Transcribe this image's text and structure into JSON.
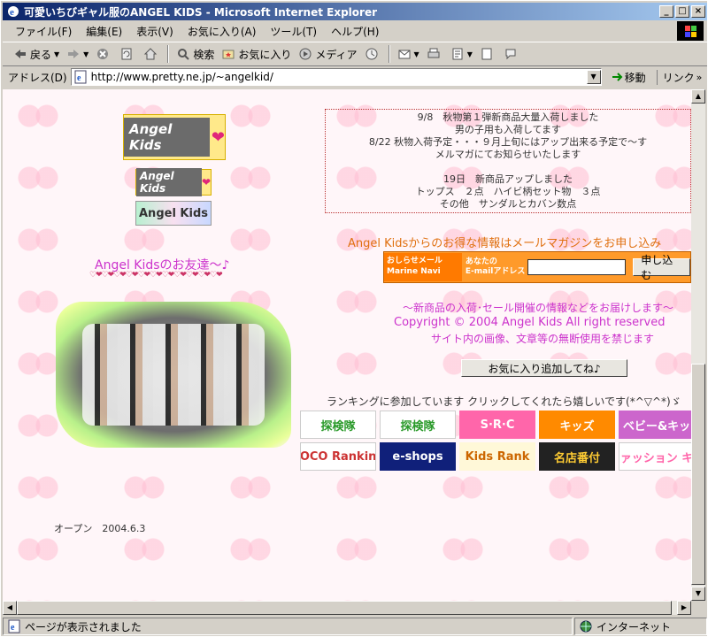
{
  "window": {
    "title": "可愛いちびギャル服のANGEL KIDS - Microsoft Internet Explorer",
    "controls": {
      "minimize": "_",
      "maximize": "□",
      "close": "×"
    }
  },
  "menu": [
    "ファイル(F)",
    "編集(E)",
    "表示(V)",
    "お気に入り(A)",
    "ツール(T)",
    "ヘルプ(H)"
  ],
  "toolbar": {
    "back": "戻る",
    "search": "検索",
    "favorites": "お気に入り",
    "media": "メディア"
  },
  "address": {
    "label": "アドレス(D)",
    "url": "http://www.pretty.ne.jp/~angelkid/",
    "go": "移動",
    "links": "リンク"
  },
  "status": {
    "text": "ページが表示されました",
    "zone": "インターネット"
  },
  "page": {
    "logo_big": "Angel Kids",
    "logo_small": "Angel Kids",
    "logo_text": "Angel Kids",
    "friends_title": "Angel Kidsのお友達～♪",
    "hearts_row": "♡❤♡❤♡❤♡❤♡❤♡❤♡❤♡❤♡❤♡❤♡❤",
    "opened": "オープン　2004.6.3",
    "news": [
      "9/8　秋物第１弾新商品大量入荷しました",
      "男の子用も入荷してます",
      "8/22 秋物入荷予定・・・９月上旬にはアップ出来る予定で～す",
      "メルマガにてお知らせいたします",
      "",
      "19日　新商品アップしました",
      "トップス　２点　ハイビ柄セット物　３点",
      "その他　サンダルとカバン数点"
    ],
    "mail_heading": "Angel Kidsからのお得な情報はメールマガジンをお申し込み",
    "mail_logo_line1": "おしらせメール",
    "mail_logo_line2": "Marine Navi",
    "mail_label_line1": "あなたの",
    "mail_label_line2": "E-mailアドレス",
    "mail_button": "申し込む",
    "notice": "～新商品の入荷･セール開催の情報などをお届けします～",
    "copyright": "Copyright  © 2004 Angel Kids  All right reserved",
    "no_reproduction": "サイト内の画像、文章等の無断使用を禁じます",
    "favorite_button": "お気に入り追加してね♪",
    "ranking_text": "ランキングに参加しています  クリックしてくれたら嬉しいです(*^▽^*)ゞ",
    "banners": [
      {
        "label": "探検隊",
        "bg": "#ffffff",
        "fg": "#2a9a2a"
      },
      {
        "label": "探検隊",
        "bg": "#ffffff",
        "fg": "#2a9a2a"
      },
      {
        "label": "S·R·C",
        "bg": "#ff66aa",
        "fg": "#ffffff"
      },
      {
        "label": "キッズ",
        "bg": "#ff8a00",
        "fg": "#ffffff"
      },
      {
        "label": "ベビー&キッ",
        "bg": "#cc66cc",
        "fg": "#ffffff"
      },
      {
        "label": "COCO Ranking",
        "bg": "#ffffff",
        "fg": "#cc3333"
      },
      {
        "label": "e-shops",
        "bg": "#10207a",
        "fg": "#ffffff"
      },
      {
        "label": "Kids Rank",
        "bg": "#fff8d8",
        "fg": "#cc6600"
      },
      {
        "label": "名店番付",
        "bg": "#222222",
        "fg": "#ffcc33"
      },
      {
        "label": "ファッション キッ",
        "bg": "#ffffff",
        "fg": "#ff66aa"
      }
    ]
  }
}
